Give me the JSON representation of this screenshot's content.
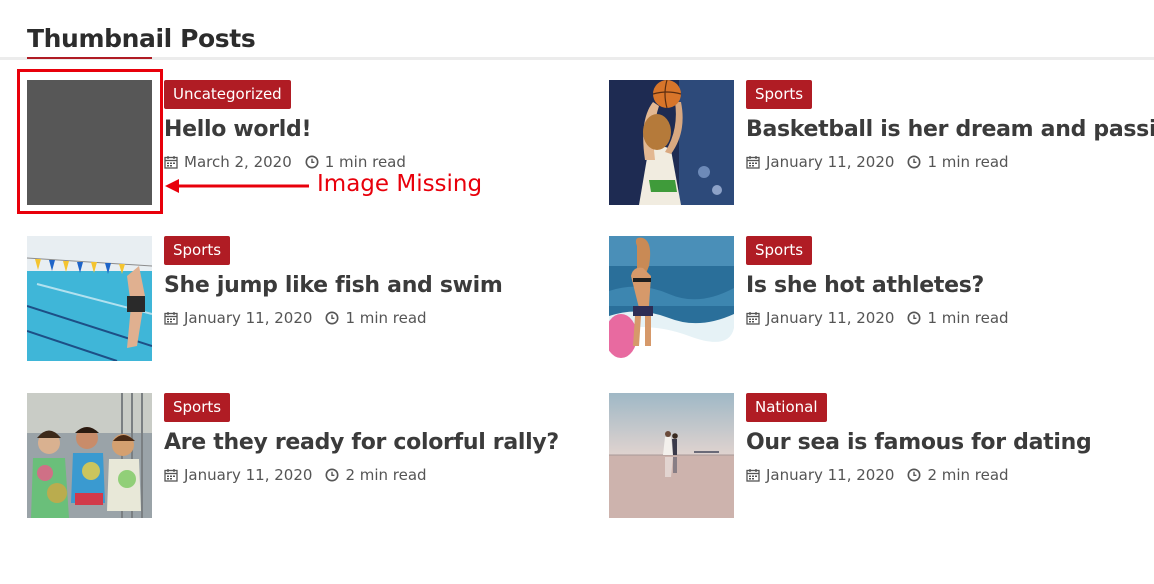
{
  "section": {
    "title": "Thumbnail Posts"
  },
  "annotation": {
    "text": "Image Missing",
    "color": "#e8000b"
  },
  "colors": {
    "accent": "#b01c24",
    "text": "#3b3b3b",
    "meta": "#555555"
  },
  "icons": {
    "date": "calendar-icon",
    "read_time": "clock-icon"
  },
  "posts": [
    {
      "category": "Uncategorized",
      "title": "Hello world!",
      "date": "March 2, 2020",
      "read_time": "1 min read",
      "thumbnail": "missing"
    },
    {
      "category": "Sports",
      "title": "Basketball is her dream and passion",
      "date": "January 11, 2020",
      "read_time": "1 min read",
      "thumbnail": "basketball"
    },
    {
      "category": "Sports",
      "title": "She jump like fish and swim",
      "date": "January 11, 2020",
      "read_time": "1 min read",
      "thumbnail": "swimming-pool"
    },
    {
      "category": "Sports",
      "title": "Is she hot athletes?",
      "date": "January 11, 2020",
      "read_time": "1 min read",
      "thumbnail": "surf"
    },
    {
      "category": "Sports",
      "title": "Are they ready for colorful rally?",
      "date": "January 11, 2020",
      "read_time": "2 min read",
      "thumbnail": "color-run"
    },
    {
      "category": "National",
      "title": "Our sea is famous for dating",
      "date": "January 11, 2020",
      "read_time": "2 min read",
      "thumbnail": "sea-couple"
    }
  ]
}
